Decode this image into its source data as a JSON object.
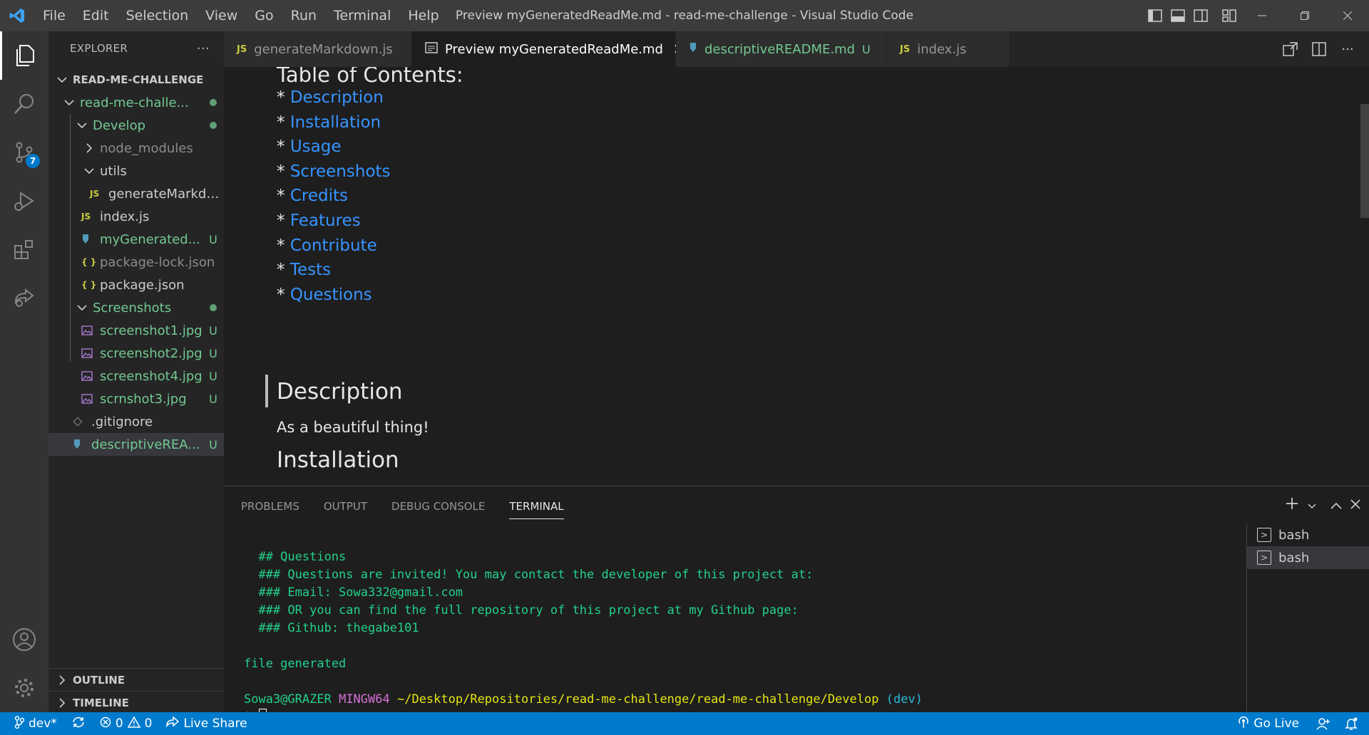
{
  "window": {
    "title": "Preview myGeneratedReadMe.md - read-me-challenge - Visual Studio Code",
    "menu": [
      "File",
      "Edit",
      "Selection",
      "View",
      "Go",
      "Run",
      "Terminal",
      "Help"
    ]
  },
  "activity_bar": {
    "scm_badge": "7"
  },
  "sidebar": {
    "header": "EXPLORER",
    "more": "···",
    "root": "READ-ME-CHALLENGE",
    "items": [
      {
        "label": "read-me-challe...",
        "kind": "folder",
        "open": true
      },
      {
        "label": "Develop",
        "kind": "folder",
        "open": true
      },
      {
        "label": "node_modules",
        "kind": "folder",
        "open": false
      },
      {
        "label": "utils",
        "kind": "folder",
        "open": true
      },
      {
        "label": "generateMarkdo...",
        "kind": "js"
      },
      {
        "label": "index.js",
        "kind": "js"
      },
      {
        "label": "myGenerated...",
        "kind": "md",
        "decoration": "U"
      },
      {
        "label": "package-lock.json",
        "kind": "json"
      },
      {
        "label": "package.json",
        "kind": "json"
      },
      {
        "label": "Screenshots",
        "kind": "folder",
        "open": true
      },
      {
        "label": "screenshot1.jpg",
        "kind": "img",
        "decoration": "U"
      },
      {
        "label": "screenshot2.jpg",
        "kind": "img",
        "decoration": "U"
      },
      {
        "label": "screenshot4.jpg",
        "kind": "img",
        "decoration": "U"
      },
      {
        "label": "scrnshot3.jpg",
        "kind": "img",
        "decoration": "U"
      },
      {
        "label": ".gitignore",
        "kind": "git"
      },
      {
        "label": "descriptiveREA...",
        "kind": "md",
        "decoration": "U"
      }
    ],
    "outline": "OUTLINE",
    "timeline": "TIMELINE"
  },
  "tabs": [
    {
      "icon": "JS",
      "label": "generateMarkdown.js"
    },
    {
      "icon": "preview",
      "label": "Preview myGeneratedReadMe.md",
      "close": "✕"
    },
    {
      "icon": "md",
      "label": "descriptiveREADME.md",
      "decoration": "U"
    },
    {
      "icon": "JS",
      "label": "index.js"
    }
  ],
  "preview": {
    "toc_title": "Table of Contents:",
    "bullet": "*",
    "toc": [
      "Description",
      "Installation",
      "Usage",
      "Screenshots",
      "Credits",
      "Features",
      "Contribute",
      "Tests",
      "Questions"
    ],
    "description_heading": "Description",
    "description_text": "As a beautiful thing!",
    "installation_heading": "Installation"
  },
  "panel": {
    "tabs": [
      "PROBLEMS",
      "OUTPUT",
      "DEBUG CONSOLE",
      "TERMINAL"
    ],
    "terminal_lines": [
      "  ## Questions",
      "  ### Questions are invited! You may contact the developer of this project at:",
      "  ### Email: Sowa332@gmail.com",
      "  ### OR you can find the full repository of this project at my Github page:",
      "  ### Github: thegabe101"
    ],
    "file_generated": "file generated",
    "prompt_user": "Sowa3@GRAZER",
    "prompt_env": "MINGW64",
    "prompt_path": "~/Desktop/Repositories/read-me-challenge/read-me-challenge/Develop",
    "prompt_branch": "(dev)",
    "prompt_symbol": "$",
    "instances": [
      "bash",
      "bash"
    ]
  },
  "statusbar": {
    "branch": "dev*",
    "errors": "0",
    "warnings": "0",
    "live_share": "Live Share",
    "go_live": "Go Live"
  },
  "colors": {
    "accent": "#007acc",
    "link": "#3794ff",
    "untracked": "#73c991"
  }
}
